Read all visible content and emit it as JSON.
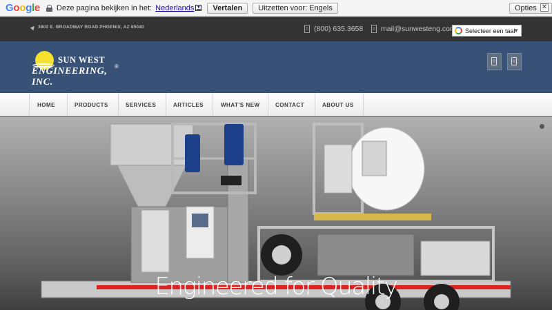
{
  "translate_bar": {
    "logo_letters": [
      "G",
      "o",
      "o",
      "g",
      "l",
      "e"
    ],
    "prompt": "Deze pagina bekijken in het:",
    "language": "Nederlands",
    "language_arrow": "▼",
    "translate_button": "Vertalen",
    "untranslate_button": "Uitzetten voor: Engels",
    "options_button": "Opties ▼",
    "close_glyph": "✕"
  },
  "topbar": {
    "address": "3802 E. BROADWAY ROAD PHOENIX, AZ 85040",
    "phone": "(800) 635.3658",
    "email": "mail@sunwesteng.com",
    "language_select": "Selecteer een taal",
    "language_select_arrow": "▼"
  },
  "header": {
    "logo_line1": "SUN WEST",
    "logo_line2": "ENGINEERING, INC.",
    "logo_reg": "®"
  },
  "nav": {
    "items": [
      {
        "label": "HOME"
      },
      {
        "label": "PRODUCTS"
      },
      {
        "label": "SERVICES"
      },
      {
        "label": "ARTICLES"
      },
      {
        "label": "WHAT'S NEW"
      },
      {
        "label": "CONTACT"
      },
      {
        "label": "ABOUT US"
      }
    ]
  },
  "hero": {
    "caption": "Engineered for Quality"
  },
  "colors": {
    "header_blue": "#375276",
    "topbar_dark": "#333333",
    "sun_yellow": "#f5e12e"
  }
}
